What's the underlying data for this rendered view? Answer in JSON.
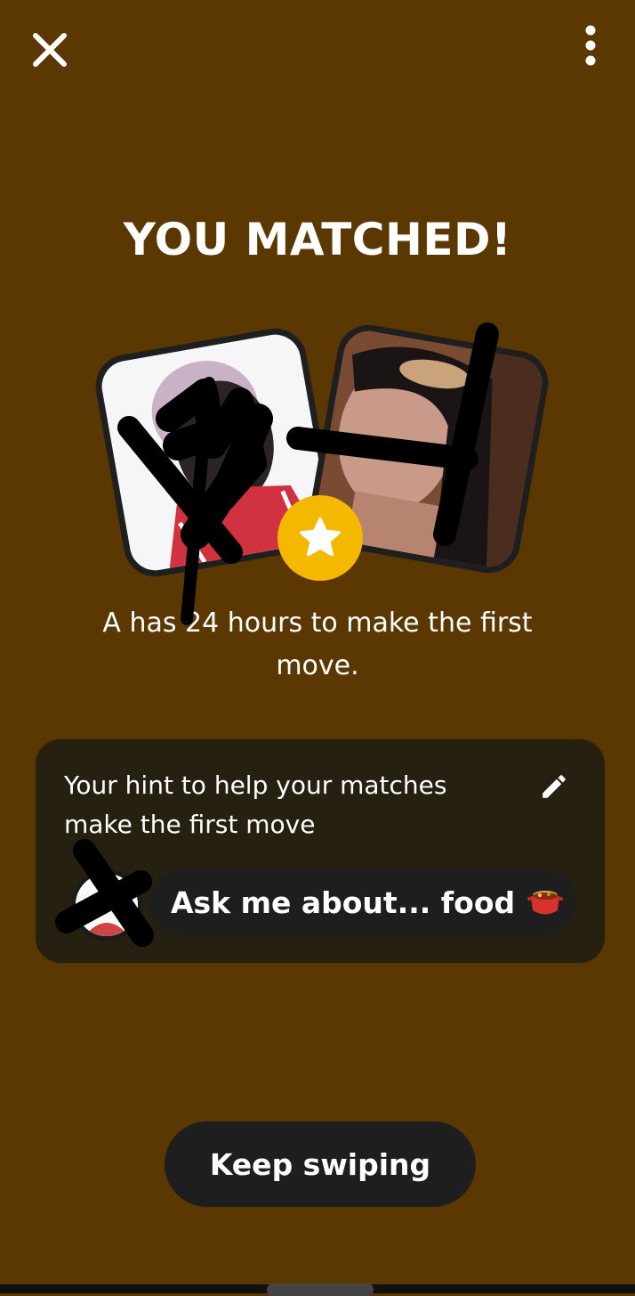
{
  "header": {
    "close_icon": "close-icon",
    "more_icon": "more-vertical-icon"
  },
  "title": "YOU MATCHED!",
  "badge_icon": "star-icon",
  "subtitle": "A has 24 hours to make the first move.",
  "hint": {
    "heading": "Your hint to help your matches make the first move",
    "edit_icon": "pencil-icon",
    "text": "Ask me about... food",
    "emoji_icon": "cooking-pot-icon"
  },
  "keep_swiping": "Keep swiping",
  "colors": {
    "background": "#5b3802",
    "accent": "#f5b800",
    "card": "#262011",
    "button": "#1e1e1e"
  }
}
